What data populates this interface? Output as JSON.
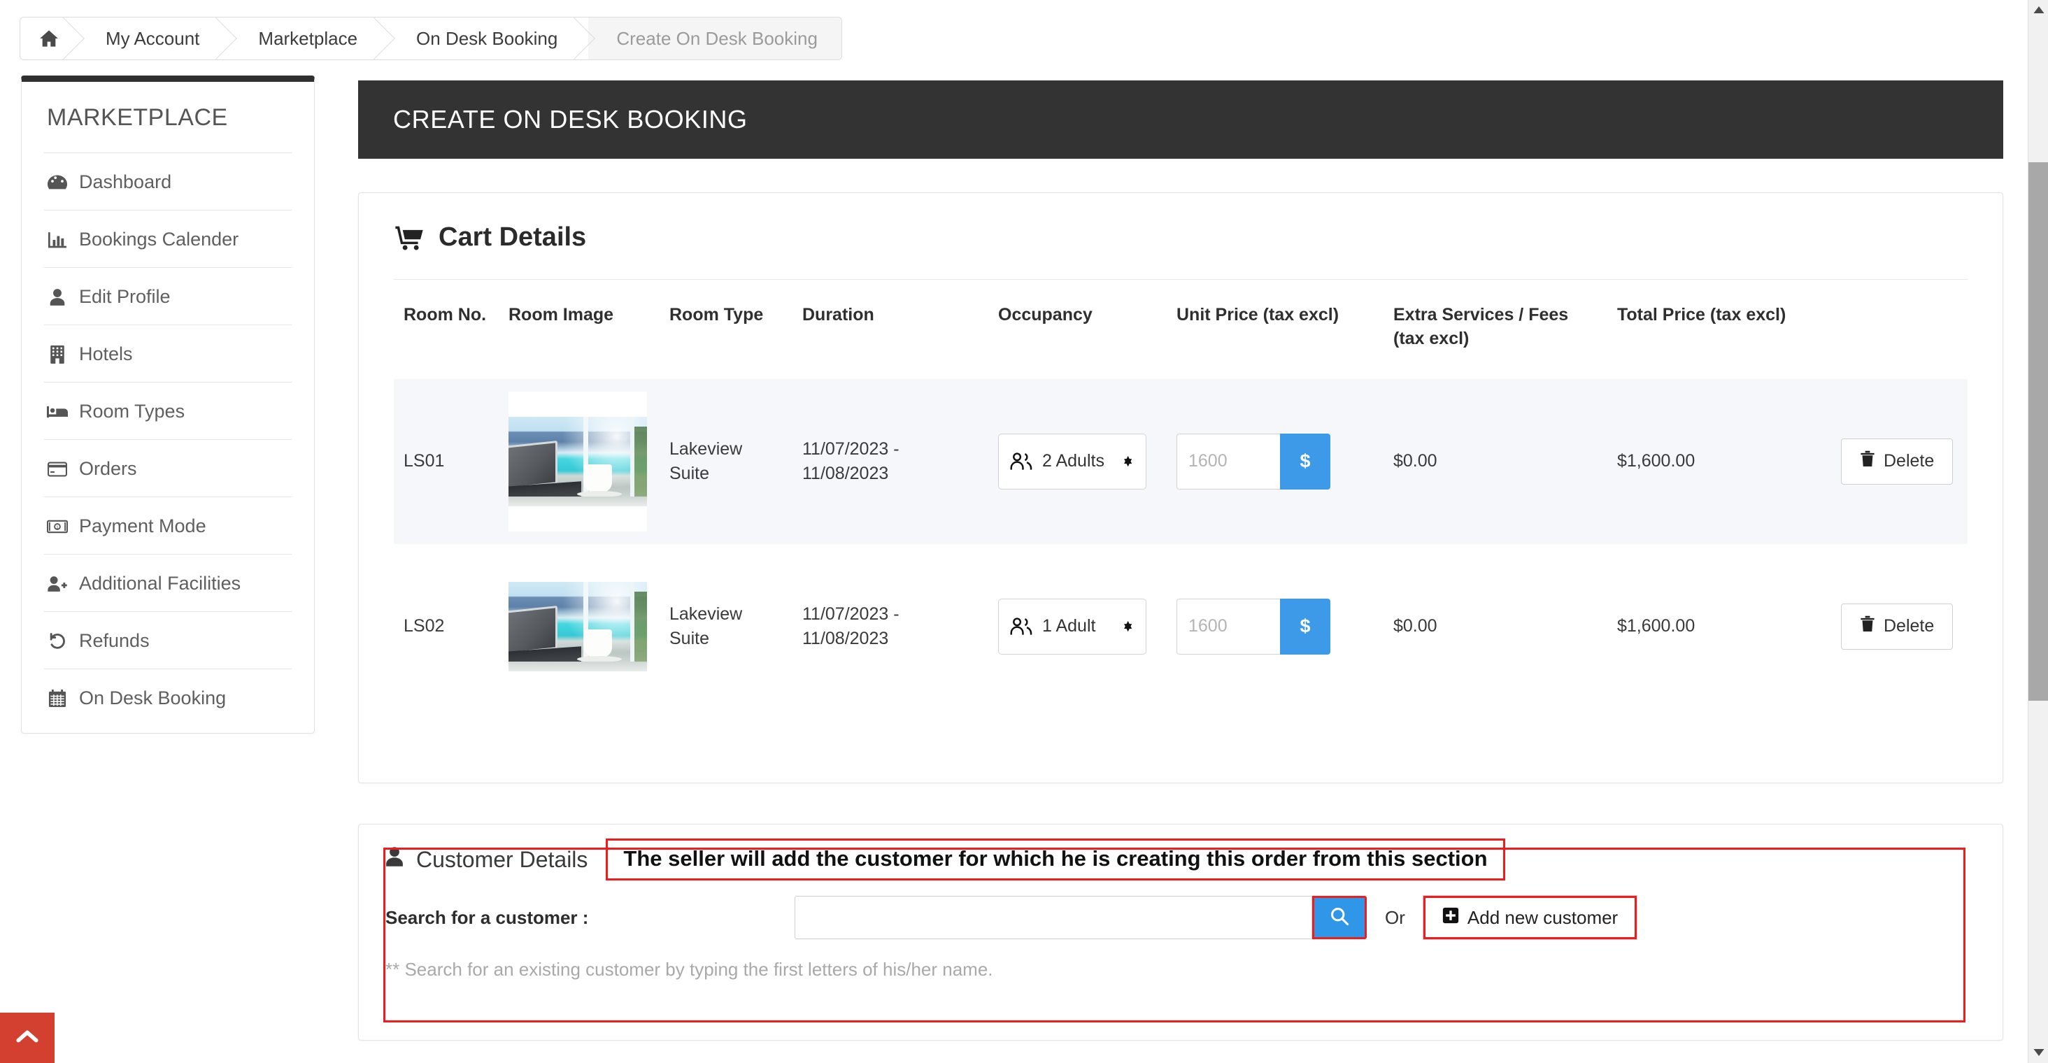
{
  "breadcrumb": {
    "home_icon": "home-icon",
    "items": [
      {
        "label": "My Account",
        "active": false
      },
      {
        "label": "Marketplace",
        "active": false
      },
      {
        "label": "On Desk Booking",
        "active": false
      },
      {
        "label": "Create On Desk Booking",
        "active": true
      }
    ]
  },
  "sidebar": {
    "title": "MARKETPLACE",
    "items": [
      {
        "label": "Dashboard",
        "icon": "dashboard-icon"
      },
      {
        "label": "Bookings Calender",
        "icon": "bar-chart-icon"
      },
      {
        "label": "Edit Profile",
        "icon": "user-icon"
      },
      {
        "label": "Hotels",
        "icon": "building-icon"
      },
      {
        "label": "Room Types",
        "icon": "bed-icon"
      },
      {
        "label": "Orders",
        "icon": "credit-card-icon"
      },
      {
        "label": "Payment Mode",
        "icon": "money-bill-icon"
      },
      {
        "label": "Additional Facilities",
        "icon": "user-plus-icon"
      },
      {
        "label": "Refunds",
        "icon": "undo-icon"
      },
      {
        "label": "On Desk Booking",
        "icon": "calendar-icon"
      }
    ]
  },
  "header": {
    "title": "CREATE ON DESK BOOKING"
  },
  "cart": {
    "title": "Cart Details",
    "title_icon": "shopping-cart-icon",
    "columns": [
      "Room No.",
      "Room Image",
      "Room Type",
      "Duration",
      "Occupancy",
      "Unit Price (tax excl)",
      "Extra Services / Fees (tax excl)",
      "Total Price (tax excl)",
      ""
    ],
    "rows": [
      {
        "room_no": "LS01",
        "room_image_alt": "lakeview-room-photo",
        "room_type": "Lakeview Suite",
        "duration": "11/07/2023 - 11/08/2023",
        "occupancy": "2 Adults",
        "occupancy_icon": "people-icon",
        "unit_price_value": "",
        "unit_price_placeholder": "1600",
        "unit_price_addon": "$",
        "extra_services": "$0.00",
        "total_price": "$1,600.00",
        "delete_label": "Delete",
        "delete_icon": "trash-icon"
      },
      {
        "room_no": "LS02",
        "room_image_alt": "lakeview-room-photo",
        "room_type": "Lakeview Suite",
        "duration": "11/07/2023 - 11/08/2023",
        "occupancy": "1 Adult",
        "occupancy_icon": "people-icon",
        "unit_price_value": "",
        "unit_price_placeholder": "1600",
        "unit_price_addon": "$",
        "extra_services": "$0.00",
        "total_price": "$1,600.00",
        "delete_label": "Delete",
        "delete_icon": "trash-icon"
      }
    ]
  },
  "customer": {
    "title": "Customer Details",
    "title_icon": "user-icon",
    "callout": "The seller will add the customer for which he is creating this order from this section",
    "search_label": "Search for a customer :",
    "search_value": "",
    "search_placeholder": "",
    "search_button_icon": "search-icon",
    "or_text": "Or",
    "add_new_label": "Add new customer",
    "add_new_icon": "plus-square-icon",
    "hint": "** Search for an existing customer by typing the first letters of his/her name."
  },
  "scroll_top": {
    "icon": "chevron-up-icon"
  },
  "scrollbar": {
    "up_icon": "caret-up-icon",
    "down_icon": "caret-down-icon"
  },
  "colors": {
    "accent_blue": "#3d9ae8",
    "header_dark": "#333333",
    "highlight_red": "#ee1c1c",
    "scrolltop_red": "#d3402f",
    "row_alt": "#f5f7fa"
  }
}
